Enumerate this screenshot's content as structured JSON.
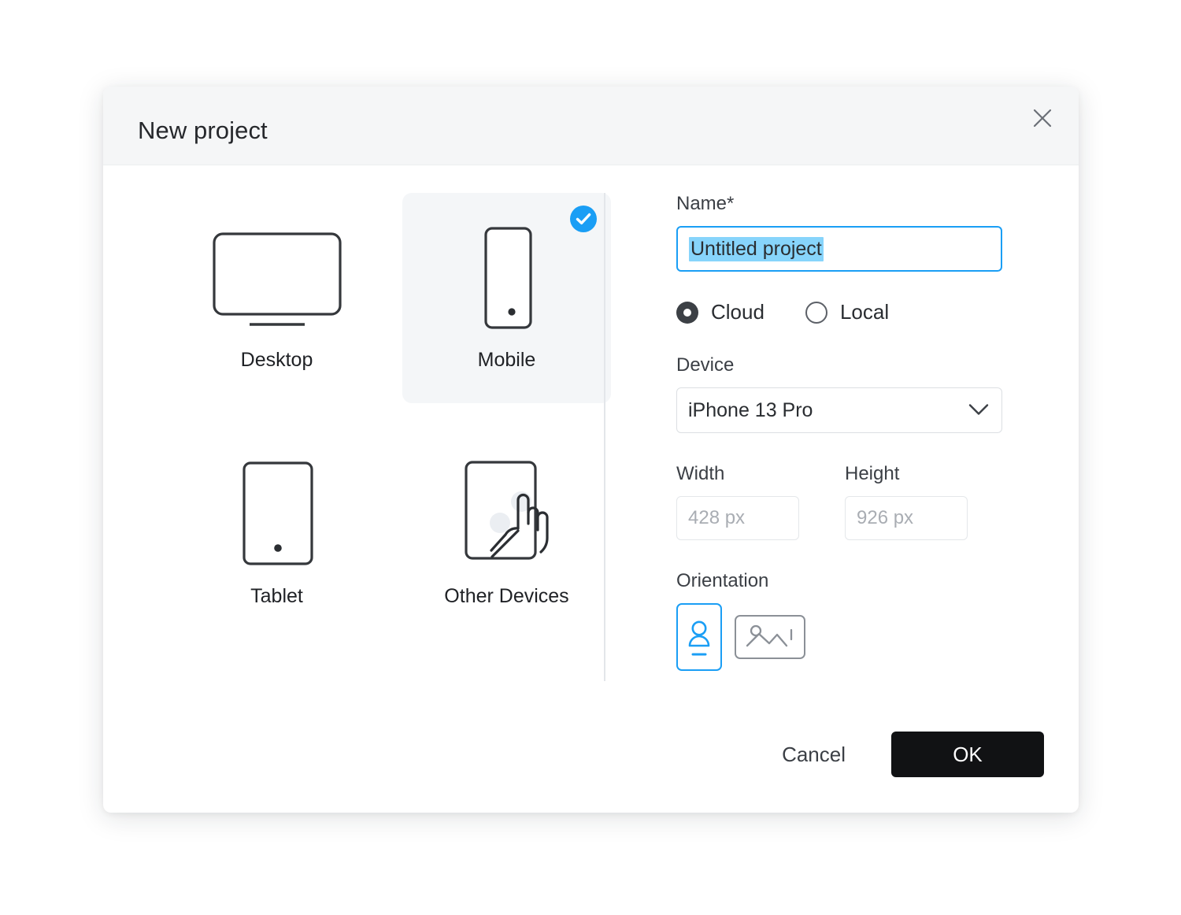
{
  "dialog": {
    "title": "New project",
    "close_icon": "close-icon"
  },
  "devices": {
    "items": [
      {
        "label": "Desktop",
        "icon": "monitor-icon",
        "selected": false
      },
      {
        "label": "Mobile",
        "icon": "phone-icon",
        "selected": true
      },
      {
        "label": "Tablet",
        "icon": "tablet-icon",
        "selected": false
      },
      {
        "label": "Other Devices",
        "icon": "touch-hand-icon",
        "selected": false
      }
    ],
    "selected_badge_icon": "check-circle-icon"
  },
  "form": {
    "name": {
      "label": "Name",
      "required_marker": "*",
      "value": "Untitled project",
      "placeholder": "Untitled project",
      "selected": true
    },
    "storage": {
      "options": [
        {
          "label": "Cloud",
          "selected": true
        },
        {
          "label": "Local",
          "selected": false
        }
      ]
    },
    "device": {
      "label": "Device",
      "value": "iPhone 13 Pro",
      "chevron_icon": "chevron-down-icon"
    },
    "width": {
      "label": "Width",
      "value": "428 px",
      "placeholder": "428 px"
    },
    "height": {
      "label": "Height",
      "value": "926 px",
      "placeholder": "926 px"
    },
    "orientation": {
      "label": "Orientation",
      "options": [
        {
          "name": "portrait",
          "icon": "portrait-phone-icon",
          "selected": true
        },
        {
          "name": "landscape",
          "icon": "landscape-image-icon",
          "selected": false
        }
      ]
    }
  },
  "footer": {
    "cancel_label": "Cancel",
    "ok_label": "OK"
  },
  "colors": {
    "accent": "#1a9ef5",
    "selection_highlight": "#87d4fb",
    "primary_button": "#111214",
    "card_selected_bg": "#f4f6f8",
    "header_bg": "#f5f6f7"
  }
}
